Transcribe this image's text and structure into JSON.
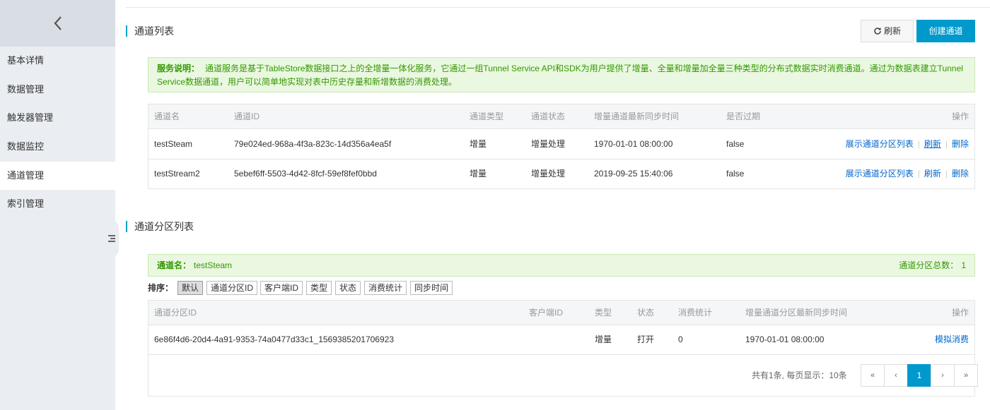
{
  "sidebar": {
    "items": [
      {
        "label": "基本详情"
      },
      {
        "label": "数据管理"
      },
      {
        "label": "触发器管理"
      },
      {
        "label": "数据监控"
      },
      {
        "label": "通道管理"
      },
      {
        "label": "索引管理"
      }
    ],
    "active_item": "通道管理"
  },
  "tunnels": {
    "title": "通道列表",
    "refresh_label": "刷新",
    "create_label": "创建通道",
    "notice_prefix": "服务说明：",
    "notice_text": "通道服务是基于TableStore数据接口之上的全增量一体化服务，它通过一组Tunnel Service API和SDK为用户提供了增量、全量和增量加全量三种类型的分布式数据实时消费通道。通过为数据表建立Tunnel Service数据通道，用户可以简单地实现对表中历史存量和新增数据的消费处理。",
    "columns": [
      "通道名",
      "通道ID",
      "通道类型",
      "通道状态",
      "增量通道最新同步时间",
      "是否过期",
      "操作"
    ],
    "rows": [
      {
        "name": "testSteam",
        "id": "79e024ed-968a-4f3a-823c-14d356a4ea5f",
        "type": "增量",
        "status": "增量处理",
        "sync_time": "1970-01-01 08:00:00",
        "expired": "false"
      },
      {
        "name": "testStream2",
        "id": "5ebef6ff-5503-4d42-8fcf-59ef8fef0bbd",
        "type": "增量",
        "status": "增量处理",
        "sync_time": "2019-09-25 15:40:06",
        "expired": "false"
      }
    ],
    "actions": {
      "show_partitions": "展示通道分区列表",
      "refresh": "刷新",
      "delete": "删除"
    }
  },
  "partitions": {
    "title": "通道分区列表",
    "tunnel_name_label": "通道名：",
    "tunnel_name": "testSteam",
    "total_label": "通道分区总数：",
    "total": "1",
    "sort_label": "排序：",
    "sort_options": [
      "默认",
      "通道分区ID",
      "客户端ID",
      "类型",
      "状态",
      "消费统计",
      "同步时间"
    ],
    "sort_active": "默认",
    "columns": [
      "通道分区ID",
      "客户端ID",
      "类型",
      "状态",
      "消费统计",
      "增量通道分区最新同步时间",
      "操作"
    ],
    "rows": [
      {
        "id": "6e86f4d6-20d4-4a91-9353-74a0477d33c1_1569385201706923",
        "client_id": "",
        "type": "增量",
        "status": "打开",
        "consumed": "0",
        "sync_time": "1970-01-01 08:00:00",
        "action": "模拟消费"
      }
    ],
    "pagination": {
      "summary": "共有1条, 每页显示：10条",
      "first": "«",
      "prev": "‹",
      "current": "1",
      "next": "›",
      "last": "»"
    }
  },
  "colors": {
    "accent": "#0099cc",
    "notice_bg": "#eaf7e1",
    "notice_text": "#339900",
    "link": "#0066cc"
  }
}
